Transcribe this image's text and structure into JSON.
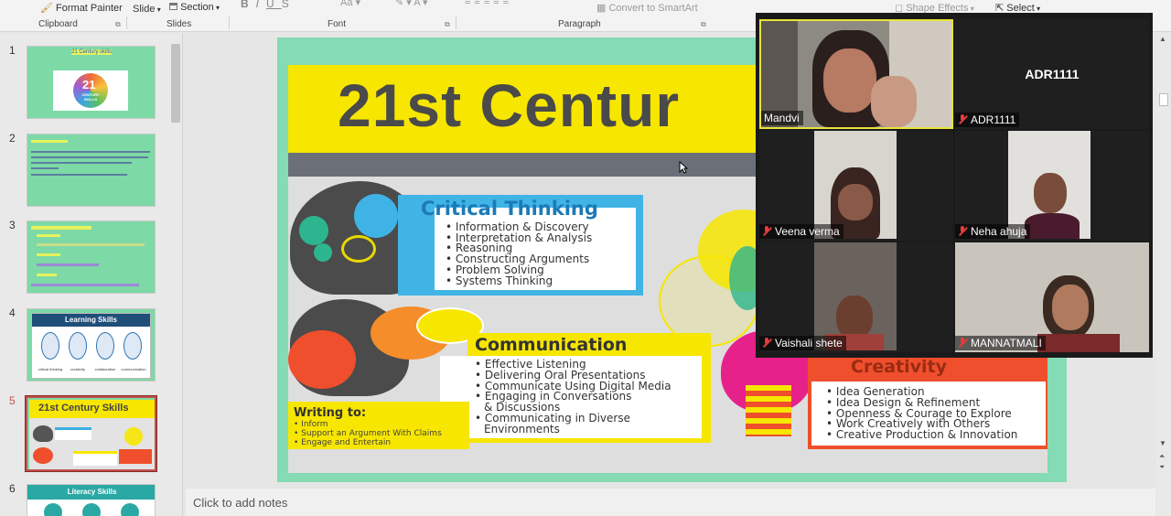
{
  "ribbon": {
    "format_painter": "Format Painter",
    "slide_label": "Slide",
    "section_label": "Section",
    "convert_smartart": "Convert to SmartArt",
    "shape_effects": "Shape Effects",
    "select_label": "Select",
    "groups": [
      "Clipboard",
      "Slides",
      "Font",
      "Paragraph"
    ]
  },
  "thumbnails": [
    {
      "num": "1",
      "title": "21 Century skills",
      "subtitle": "CENTURY SKILLS",
      "big": "21"
    },
    {
      "num": "2"
    },
    {
      "num": "3"
    },
    {
      "num": "4",
      "title": "Learning Skills",
      "labels": [
        "critical thinking",
        "creativity",
        "collaboration",
        "communication"
      ]
    },
    {
      "num": "5",
      "title": "21st Century Skills",
      "selected": true
    },
    {
      "num": "6",
      "title": "Literacy Skills"
    }
  ],
  "slide": {
    "title": "21st Centur",
    "critical": {
      "heading": "Critical Thinking",
      "items": [
        "Information & Discovery",
        "Interpretation & Analysis",
        "Reasoning",
        "Constructing Arguments",
        "Problem Solving",
        "Systems Thinking"
      ]
    },
    "communication": {
      "heading": "Communication",
      "items": [
        "Effective Listening",
        "Delivering Oral Presentations",
        "Communicate Using Digital Media",
        "Engaging in Conversations",
        "& Discussions",
        "Communicating in Diverse",
        "Environments"
      ]
    },
    "writing": {
      "heading": "Writing to:",
      "items": [
        "Inform",
        "Support an Argument With Claims",
        "Engage and Entertain"
      ]
    },
    "creativity": {
      "heading": "Creativity",
      "items": [
        "Idea Generation",
        "Idea Design & Refinement",
        "Openness & Courage to Explore",
        "Work Creatively with Others",
        "Creative Production & Innovation"
      ]
    }
  },
  "notes": {
    "placeholder": "Click to add notes"
  },
  "participants": [
    {
      "name": "Mandvi",
      "muted": false,
      "active": true
    },
    {
      "name": "ADR1111",
      "muted": true,
      "center_label": "ADR1111"
    },
    {
      "name": "Veena verma",
      "muted": true
    },
    {
      "name": "Neha ahuja",
      "muted": true
    },
    {
      "name": "Vaishali shete",
      "muted": true
    },
    {
      "name": "MANNATMALI",
      "muted": true
    }
  ]
}
